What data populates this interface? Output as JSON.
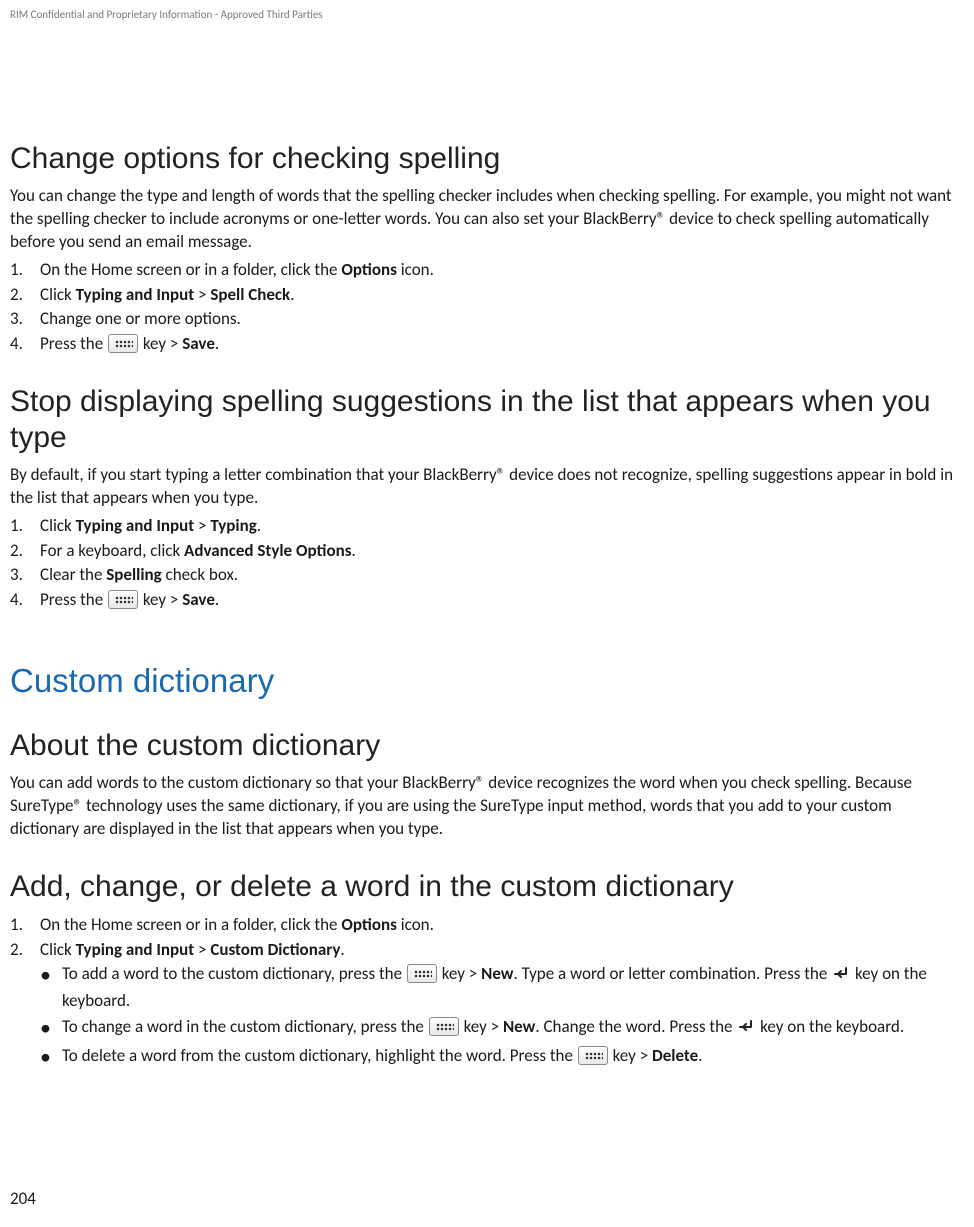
{
  "confidential": "RIM Confidential and Proprietary Information - Approved Third Parties",
  "section1": {
    "heading": "Change options for checking spelling",
    "intro": "You can change the type and length of words that the spelling checker includes when checking spelling. For example, you might not want the spelling checker to include acronyms or one-letter words. You can also set your BlackBerry® device to check spelling automatically before you send an email message.",
    "step1_a": "On the Home screen or in a folder, click the ",
    "step1_b": "Options",
    "step1_c": " icon.",
    "step2_a": "Click ",
    "step2_b": "Typing and Input",
    "step2_c": " > ",
    "step2_d": "Spell Check",
    "step2_e": ".",
    "step3": "Change one or more options.",
    "step4_a": "Press the ",
    "step4_b": " key > ",
    "step4_c": "Save",
    "step4_d": "."
  },
  "section2": {
    "heading": "Stop displaying spelling suggestions in the list that appears when you type",
    "intro": "By default, if you start typing a letter combination that your BlackBerry® device does not recognize, spelling suggestions appear in bold in the list that appears when you type.",
    "step1_a": "Click ",
    "step1_b": "Typing and Input",
    "step1_c": " > ",
    "step1_d": "Typing",
    "step1_e": ".",
    "step2_a": "For a keyboard, click ",
    "step2_b": "Advanced Style Options",
    "step2_c": ".",
    "step3_a": "Clear the ",
    "step3_b": "Spelling",
    "step3_c": " check box.",
    "step4_a": "Press the ",
    "step4_b": " key > ",
    "step4_c": "Save",
    "step4_d": "."
  },
  "section3": {
    "heading": "Custom dictionary",
    "sub1": {
      "heading": "About the custom dictionary",
      "body": "You can add words to the custom dictionary so that your BlackBerry® device recognizes the word when you check spelling. Because SureType® technology uses the same dictionary, if you are using the SureType input method, words that you add to your custom dictionary are displayed in the list that appears when you type."
    },
    "sub2": {
      "heading": "Add, change, or delete a word in the custom dictionary",
      "step1_a": "On the Home screen or in a folder, click the ",
      "step1_b": "Options",
      "step1_c": " icon.",
      "step2_a": "Click ",
      "step2_b": "Typing and Input",
      "step2_c": " > ",
      "step2_d": "Custom Dictionary",
      "step2_e": ".",
      "bul1_a": "To add a word to the custom dictionary, press the ",
      "bul1_b": " key > ",
      "bul1_c": "New",
      "bul1_d": ". Type a word or letter combination. Press the ",
      "bul1_e": " key on the keyboard.",
      "bul2_a": "To change a word in the custom dictionary, press the ",
      "bul2_b": " key > ",
      "bul2_c": "New",
      "bul2_d": ". Change the word. Press the ",
      "bul2_e": " key on the keyboard.",
      "bul3_a": "To delete a word from the custom dictionary, highlight the word. Press the ",
      "bul3_b": " key > ",
      "bul3_c": "Delete",
      "bul3_d": "."
    }
  },
  "page_number": "204"
}
